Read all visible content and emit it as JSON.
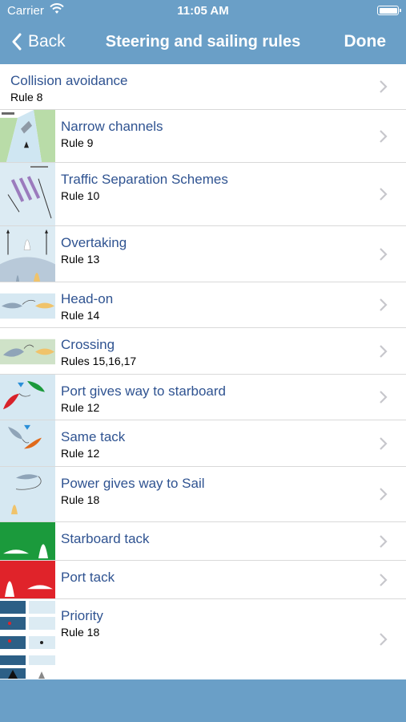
{
  "status": {
    "carrier": "Carrier",
    "time": "11:05 AM"
  },
  "nav": {
    "back_label": "Back",
    "title": "Steering and sailing rules",
    "done_label": "Done"
  },
  "items": [
    {
      "title": "Collision avoidance",
      "subtitle": "Rule 8"
    },
    {
      "title": "Narrow channels",
      "subtitle": "Rule 9"
    },
    {
      "title": "Traffic Separation Schemes",
      "subtitle": "Rule 10"
    },
    {
      "title": "Overtaking",
      "subtitle": "Rule 13"
    },
    {
      "title": "Head-on",
      "subtitle": "Rule 14"
    },
    {
      "title": "Crossing",
      "subtitle": "Rules 15,16,17"
    },
    {
      "title": "Port gives way to starboard",
      "subtitle": "Rule 12"
    },
    {
      "title": "Same tack",
      "subtitle": "Rule 12"
    },
    {
      "title": "Power gives way to Sail",
      "subtitle": "Rule 18"
    },
    {
      "title": "Starboard tack",
      "subtitle": ""
    },
    {
      "title": "Port tack",
      "subtitle": ""
    },
    {
      "title": "Priority",
      "subtitle": "Rule 18"
    }
  ],
  "colors": {
    "bar": "#6a9fc7",
    "title_text": "#2f5391",
    "starboard_green": "#1b9a3c",
    "port_red": "#e0232a"
  },
  "icons": [
    "wifi-icon",
    "battery-icon",
    "back-chevron-icon",
    "chevron-right-icon"
  ]
}
